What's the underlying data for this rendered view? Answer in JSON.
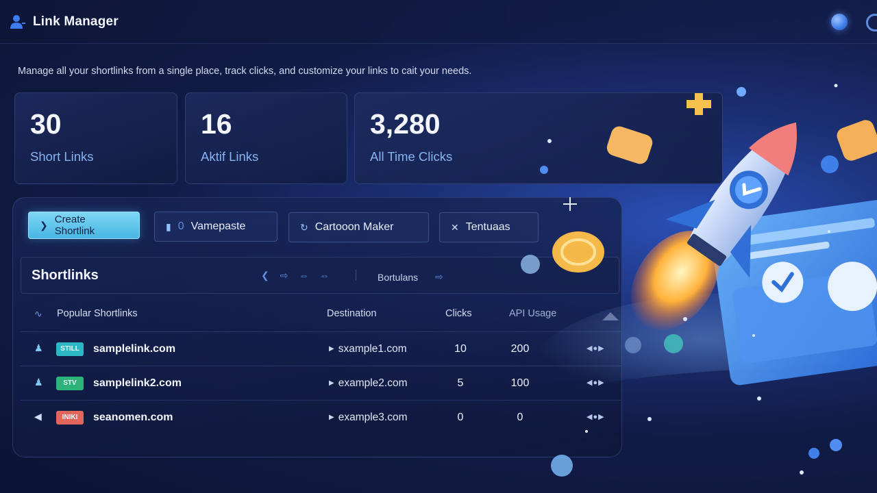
{
  "app": {
    "title": "Link Manager"
  },
  "subtitle": "Manage all your shortlinks from a single place, track clicks, and customize your links to cait your needs.",
  "stats": [
    {
      "value": "30",
      "label": "Short Links"
    },
    {
      "value": "16",
      "label": "Aktif Links"
    },
    {
      "value": "3,280",
      "label": "All Time Clicks"
    }
  ],
  "toolbar": {
    "create_label": "Create Shortlink",
    "vamepaste_count": "0",
    "vamepaste_label": "Vamepaste",
    "cartoon_label": "Cartooon Maker",
    "tentuaas_label": "Tentuaas"
  },
  "shortlinks": {
    "title": "Shortlinks",
    "column_label": "Bortulans"
  },
  "table": {
    "headers": {
      "name": "Popular Shortlinks",
      "destination": "Destination",
      "clicks": "Clicks",
      "api": "API Usage"
    },
    "rows": [
      {
        "badge": "STILL",
        "badge_color": "#2bb7c4",
        "name": "samplelink.com",
        "destination": "sxample1.com",
        "clicks": "10",
        "api": "200"
      },
      {
        "badge": "STV",
        "badge_color": "#2bb37a",
        "name": "samplelink2.com",
        "destination": "example2.com",
        "clicks": "5",
        "api": "100"
      },
      {
        "badge": "INIKI",
        "badge_color": "#e2665b",
        "name": "seanomen.com",
        "destination": "example3.com",
        "clicks": "0",
        "api": "0"
      }
    ]
  },
  "colors": {
    "accent": "#48b6e3",
    "background": "#111c47",
    "stat_label": "#86b4f2"
  },
  "icons": {
    "brand": "user-icon",
    "create": "chevron-down-icon",
    "vamepaste": "bookmark-icon",
    "cartoon": "refresh-icon",
    "tentuaas": "close-icon"
  }
}
